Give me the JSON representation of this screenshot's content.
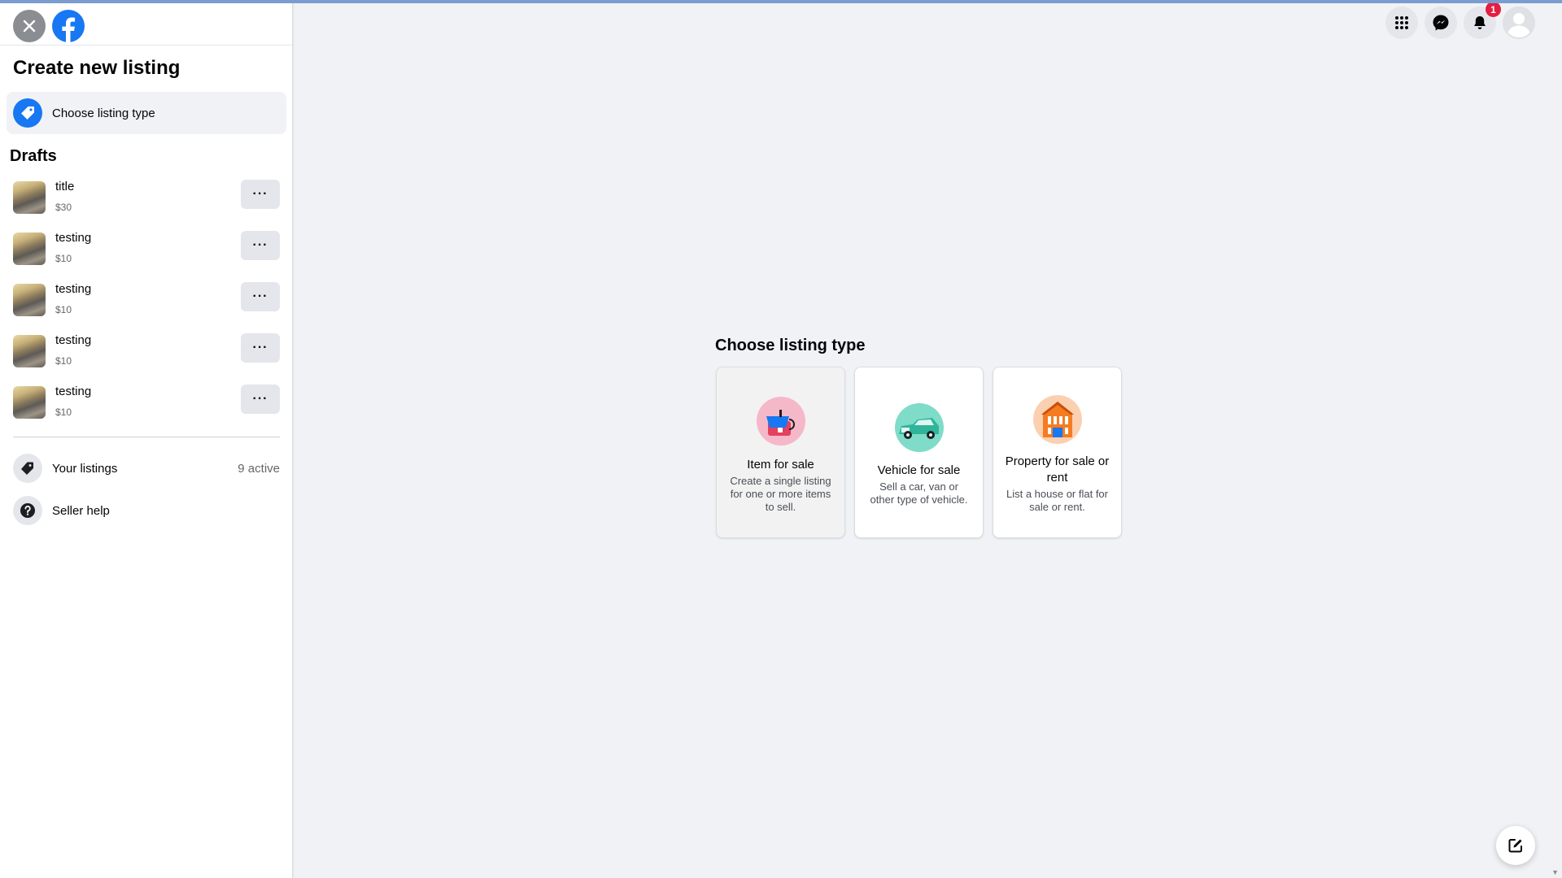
{
  "colors": {
    "brand": "#1877f2",
    "badge": "#e41e3f",
    "bg": "#f0f2f5"
  },
  "sidebar": {
    "title": "Create new listing",
    "choose_label": "Choose listing type",
    "drafts_title": "Drafts",
    "drafts": [
      {
        "title": "title",
        "price": "$30",
        "more": "···"
      },
      {
        "title": "testing",
        "price": "$10",
        "more": "···"
      },
      {
        "title": "testing",
        "price": "$10",
        "more": "···"
      },
      {
        "title": "testing",
        "price": "$10",
        "more": "···"
      },
      {
        "title": "testing",
        "price": "$10",
        "more": "···"
      }
    ],
    "your_listings": "Your listings",
    "active_count": "9 active",
    "seller_help": "Seller help"
  },
  "header": {
    "notification_count": "1"
  },
  "main": {
    "title": "Choose listing type",
    "cards": [
      {
        "title": "Item for sale",
        "desc": "Create a single listing for one or more items to sell."
      },
      {
        "title": "Vehicle for sale",
        "desc": "Sell a car, van or other type of vehicle."
      },
      {
        "title": "Property for sale or rent",
        "desc": "List a house or flat for sale or rent."
      }
    ]
  }
}
